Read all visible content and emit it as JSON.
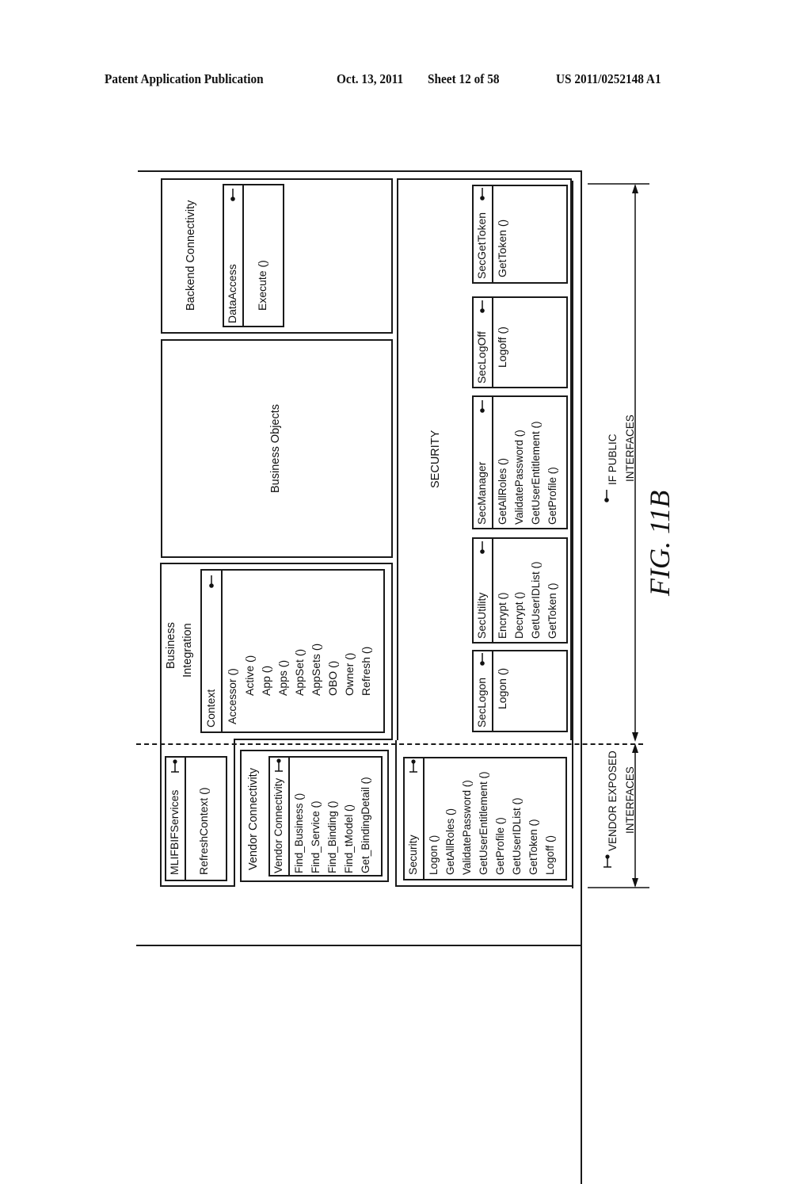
{
  "header": {
    "publication": "Patent Application Publication",
    "date": "Oct. 13, 2011",
    "sheet": "Sheet 12 of 58",
    "number": "US 2011/0252148 A1"
  },
  "figure_label": "FIG. 11B",
  "groups": {
    "backend_connectivity": {
      "title": "Backend Connectivity"
    },
    "business_objects": {
      "title": "Business Objects"
    },
    "business_integration": {
      "title_line1": "Business",
      "title_line2": "Integration"
    },
    "security": {
      "title": "SECURITY"
    },
    "vendor_connectivity": {
      "title": "Vendor Connectivity"
    }
  },
  "classes": {
    "data_access": {
      "name": "DataAccess",
      "methods": [
        "Execute ()"
      ],
      "interface": "public"
    },
    "context": {
      "name": "Context",
      "methods": [
        "Accessor ()",
        "Active ()",
        "App ()",
        "Apps ()",
        "AppSet ()",
        "AppSets ()",
        "OBO ()",
        "Owner ()",
        "Refresh ()"
      ],
      "interface": "public"
    },
    "sec_logon": {
      "name": "SecLogon",
      "methods": [
        "Logon ()"
      ],
      "interface": "public"
    },
    "sec_utility": {
      "name": "SecUtility",
      "methods": [
        "Encrypt ()",
        "Decrypt ()",
        "GetUserIDList ()",
        "GetToken ()"
      ],
      "interface": "public"
    },
    "sec_manager": {
      "name": "SecManager",
      "methods": [
        "GetAllRoles ()",
        "ValidatePassword ()",
        "GetUserEntitlement ()",
        "GetProfile ()"
      ],
      "interface": "public"
    },
    "sec_logoff": {
      "name": "SecLogOff",
      "methods": [
        "Logoff ()"
      ],
      "interface": "public"
    },
    "sec_get_token": {
      "name": "SecGetToken",
      "methods": [
        "GetToken ()"
      ],
      "interface": "public"
    },
    "mlifbif_services": {
      "name": "MLIFBIFServices",
      "methods": [
        "RefreshContext ()"
      ],
      "interface": "vendor"
    },
    "vendor_connectivity": {
      "name": "Vendor Connectivity",
      "methods": [
        "Find_Business ()",
        "Find_Service ()",
        "Find_Binding ()",
        "Find_tModel ()",
        "Get_BindingDetail ()"
      ],
      "interface": "vendor"
    },
    "security": {
      "name": "Security",
      "methods": [
        "Logon ()",
        "GetAllRoles ()",
        "ValidatePassword ()",
        "GetUserEntitlement ()",
        "GetProfile ()",
        "GetUserIDList ()",
        "GetToken ()",
        "Logoff ()"
      ],
      "interface": "vendor"
    }
  },
  "legend": {
    "public": {
      "line1": "IF PUBLIC",
      "line2": "INTERFACES"
    },
    "vendor": {
      "line1": "VENDOR EXPOSED",
      "line2": "INTERFACES"
    }
  }
}
